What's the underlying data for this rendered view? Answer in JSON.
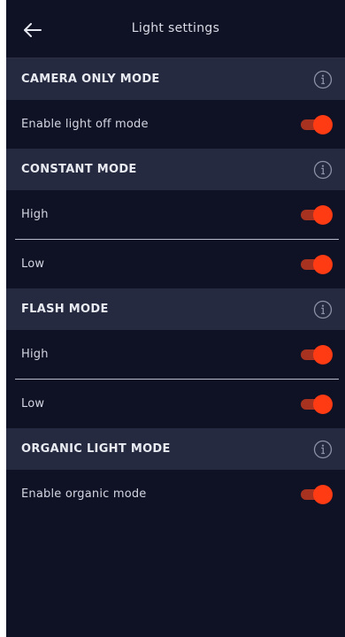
{
  "header": {
    "title": "Light settings"
  },
  "colors": {
    "accent": "#ff3b14",
    "background": "#0f1124",
    "section": "#262a40"
  },
  "sections": [
    {
      "title": "CAMERA ONLY MODE",
      "rows": [
        {
          "label": "Enable light off mode",
          "on": true
        }
      ]
    },
    {
      "title": "CONSTANT MODE",
      "rows": [
        {
          "label": "High",
          "on": true
        },
        {
          "label": "Low",
          "on": true
        }
      ]
    },
    {
      "title": "FLASH MODE",
      "rows": [
        {
          "label": "High",
          "on": true
        },
        {
          "label": "Low",
          "on": true
        }
      ]
    },
    {
      "title": "ORGANIC LIGHT MODE",
      "rows": [
        {
          "label": "Enable organic mode",
          "on": true
        }
      ]
    }
  ]
}
